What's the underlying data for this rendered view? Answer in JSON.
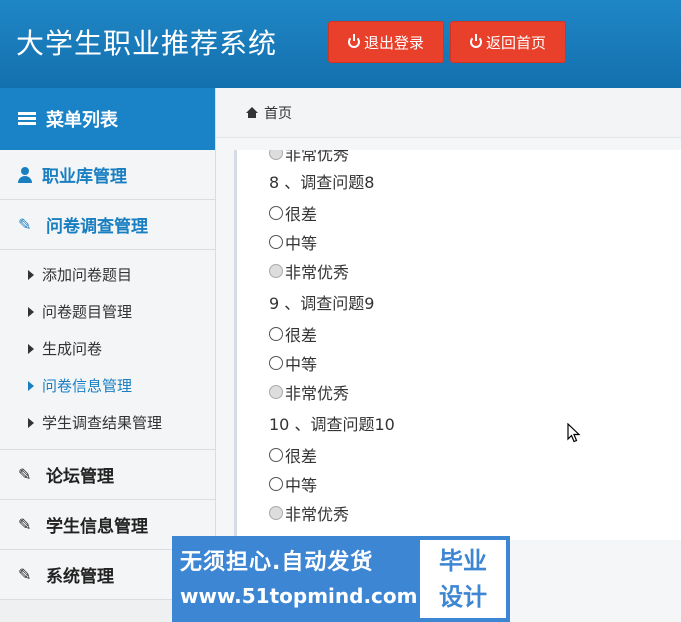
{
  "header": {
    "title": "大学生职业推荐系统",
    "logout_label": "退出登录",
    "home_label": "返回首页"
  },
  "sidebar": {
    "menu_title": "菜单列表",
    "items": [
      {
        "label": "职业库管理"
      },
      {
        "label": "问卷调查管理"
      },
      {
        "label": "论坛管理"
      },
      {
        "label": "学生信息管理"
      },
      {
        "label": "系统管理"
      }
    ],
    "sub_items": [
      {
        "label": "添加问卷题目"
      },
      {
        "label": "问卷题目管理"
      },
      {
        "label": "生成问卷"
      },
      {
        "label": "问卷信息管理"
      },
      {
        "label": "学生调查结果管理"
      }
    ]
  },
  "breadcrumb": {
    "label": "首页"
  },
  "survey": {
    "top_option": "非常优秀",
    "questions": [
      {
        "title": "8 、调查问题8",
        "options": [
          "很差",
          "中等",
          "非常优秀"
        ]
      },
      {
        "title": "9 、调查问题9",
        "options": [
          "很差",
          "中等",
          "非常优秀"
        ]
      },
      {
        "title": "10 、调查问题10",
        "options": [
          "很差",
          "中等",
          "非常优秀"
        ]
      }
    ]
  },
  "watermark": {
    "line1": "无须担心.自动发货",
    "line2": "www.51topmind.com",
    "badge_top": "毕业",
    "badge_bottom": "设计"
  },
  "colors": {
    "header_bg": "#1a7abc",
    "accent": "#1a7fc1",
    "button_red": "#e8402a"
  }
}
